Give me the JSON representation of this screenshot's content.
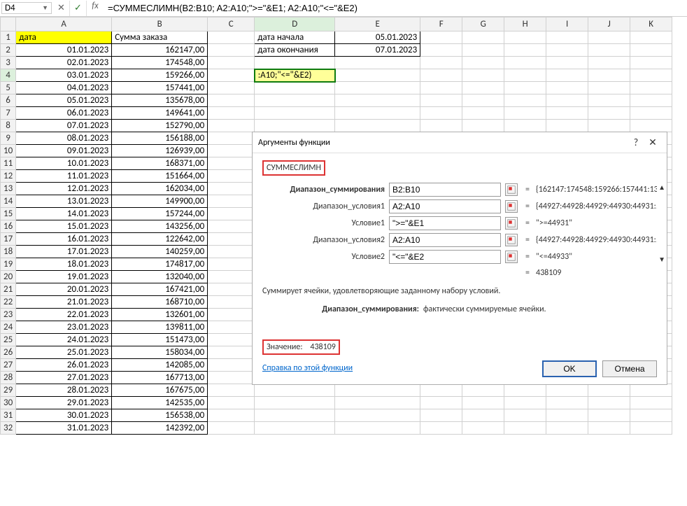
{
  "formula_bar": {
    "name_box": "D4",
    "formula": "=СУММЕСЛИМН(B2:B10; A2:A10;\">=\"&E1; A2:A10;\"<=\"&E2)"
  },
  "headers_cols": [
    "A",
    "B",
    "C",
    "D",
    "E",
    "F",
    "G",
    "H",
    "I",
    "J",
    "K"
  ],
  "table": {
    "hdr_a": "дата",
    "hdr_b": "Сумма заказа",
    "rows": [
      {
        "n": 1
      },
      {
        "n": 2,
        "a": "01.01.2023",
        "b": "162147,00"
      },
      {
        "n": 3,
        "a": "02.01.2023",
        "b": "174548,00"
      },
      {
        "n": 4,
        "a": "03.01.2023",
        "b": "159266,00"
      },
      {
        "n": 5,
        "a": "04.01.2023",
        "b": "157441,00"
      },
      {
        "n": 6,
        "a": "05.01.2023",
        "b": "135678,00"
      },
      {
        "n": 7,
        "a": "06.01.2023",
        "b": "149641,00"
      },
      {
        "n": 8,
        "a": "07.01.2023",
        "b": "152790,00"
      },
      {
        "n": 9,
        "a": "08.01.2023",
        "b": "156188,00"
      },
      {
        "n": 10,
        "a": "09.01.2023",
        "b": "126939,00"
      },
      {
        "n": 11,
        "a": "10.01.2023",
        "b": "168371,00"
      },
      {
        "n": 12,
        "a": "11.01.2023",
        "b": "151664,00"
      },
      {
        "n": 13,
        "a": "12.01.2023",
        "b": "162034,00"
      },
      {
        "n": 14,
        "a": "13.01.2023",
        "b": "149900,00"
      },
      {
        "n": 15,
        "a": "14.01.2023",
        "b": "157244,00"
      },
      {
        "n": 16,
        "a": "15.01.2023",
        "b": "143256,00"
      },
      {
        "n": 17,
        "a": "16.01.2023",
        "b": "122642,00"
      },
      {
        "n": 18,
        "a": "17.01.2023",
        "b": "140259,00"
      },
      {
        "n": 19,
        "a": "18.01.2023",
        "b": "174817,00"
      },
      {
        "n": 20,
        "a": "19.01.2023",
        "b": "132040,00"
      },
      {
        "n": 21,
        "a": "20.01.2023",
        "b": "167421,00"
      },
      {
        "n": 22,
        "a": "21.01.2023",
        "b": "168710,00"
      },
      {
        "n": 23,
        "a": "22.01.2023",
        "b": "132601,00"
      },
      {
        "n": 24,
        "a": "23.01.2023",
        "b": "139811,00"
      },
      {
        "n": 25,
        "a": "24.01.2023",
        "b": "151473,00"
      },
      {
        "n": 26,
        "a": "25.01.2023",
        "b": "158034,00"
      },
      {
        "n": 27,
        "a": "26.01.2023",
        "b": "142085,00"
      },
      {
        "n": 28,
        "a": "27.01.2023",
        "b": "167713,00"
      },
      {
        "n": 29,
        "a": "28.01.2023",
        "b": "167675,00"
      },
      {
        "n": 30,
        "a": "29.01.2023",
        "b": "142535,00"
      },
      {
        "n": 31,
        "a": "30.01.2023",
        "b": "156538,00"
      },
      {
        "n": 32,
        "a": "31.01.2023",
        "b": "142392,00"
      }
    ]
  },
  "side": {
    "d1": "дата начала",
    "e1": "05.01.2023",
    "d2": "дата окончания",
    "e2": "07.01.2023",
    "d4": ":A10;\"<=\"&E2)"
  },
  "dialog": {
    "title": "Аргументы функции",
    "fn_name": "СУММЕСЛИМН",
    "args": [
      {
        "label": "Диапазон_суммирования",
        "bold": true,
        "val": "B2:B10",
        "res": "{162147:174548:159266:157441:13..."
      },
      {
        "label": "Диапазон_условия1",
        "bold": false,
        "val": "A2:A10",
        "res": "{44927:44928:44929:44930:44931:..."
      },
      {
        "label": "Условие1",
        "bold": false,
        "val": "\">=\"&E1",
        "res": "\">=44931\""
      },
      {
        "label": "Диапазон_условия2",
        "bold": false,
        "val": "A2:A10",
        "res": "{44927:44928:44929:44930:44931:..."
      },
      {
        "label": "Условие2",
        "bold": false,
        "val": "\"<=\"&E2",
        "res": "\"<=44933\""
      }
    ],
    "final_eq": "=",
    "final_res": "438109",
    "desc": "Суммирует ячейки, удовлетворяющие заданному набору условий.",
    "desc_arg_label": "Диапазон_суммирования:",
    "desc_arg_text": "фактически суммируемые ячейки.",
    "result_label": "Значение:",
    "result_val": "438109",
    "help": "Справка по этой функции",
    "ok": "OK",
    "cancel": "Отмена",
    "help_q": "?",
    "close": "✕"
  }
}
